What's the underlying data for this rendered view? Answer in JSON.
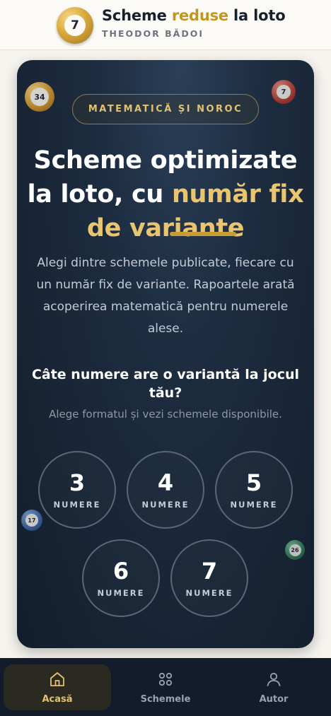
{
  "header": {
    "logo_number": "7",
    "title_part1": "Scheme ",
    "title_accent": "reduse",
    "title_part2": " la loto",
    "subtitle": "THEODOR BĂDOI"
  },
  "hero": {
    "badge": "MATEMATICĂ ȘI NOROC",
    "headline_line1": "Scheme optimizate",
    "headline_line2_white": "la loto, cu ",
    "headline_line2_gold": "număr fix",
    "headline_line3": "de variante",
    "lead": "Alegi dintre schemele publicate, fiecare cu un număr fix de variante. Rapoartele arată acoperirea matematică pentru numerele alese.",
    "question": "Câte numere are o variantă la jocul tău?",
    "question_sub": "Alege formatul și vezi schemele disponibile.",
    "decor_balls": [
      "34",
      "7",
      "17",
      "26"
    ],
    "options": [
      {
        "number": "3",
        "label": "NUMERE"
      },
      {
        "number": "4",
        "label": "NUMERE"
      },
      {
        "number": "5",
        "label": "NUMERE"
      },
      {
        "number": "6",
        "label": "NUMERE"
      },
      {
        "number": "7",
        "label": "NUMERE"
      }
    ]
  },
  "nav": {
    "items": [
      {
        "label": "Acasă",
        "icon": "home-icon",
        "active": true
      },
      {
        "label": "Schemele",
        "icon": "grid-icon",
        "active": false
      },
      {
        "label": "Autor",
        "icon": "user-icon",
        "active": false
      }
    ]
  },
  "colors": {
    "accent_gold": "#c2961f",
    "hero_gold": "#eac570",
    "hero_bg": "#1c2b3e",
    "nav_bg": "#121c2a"
  }
}
